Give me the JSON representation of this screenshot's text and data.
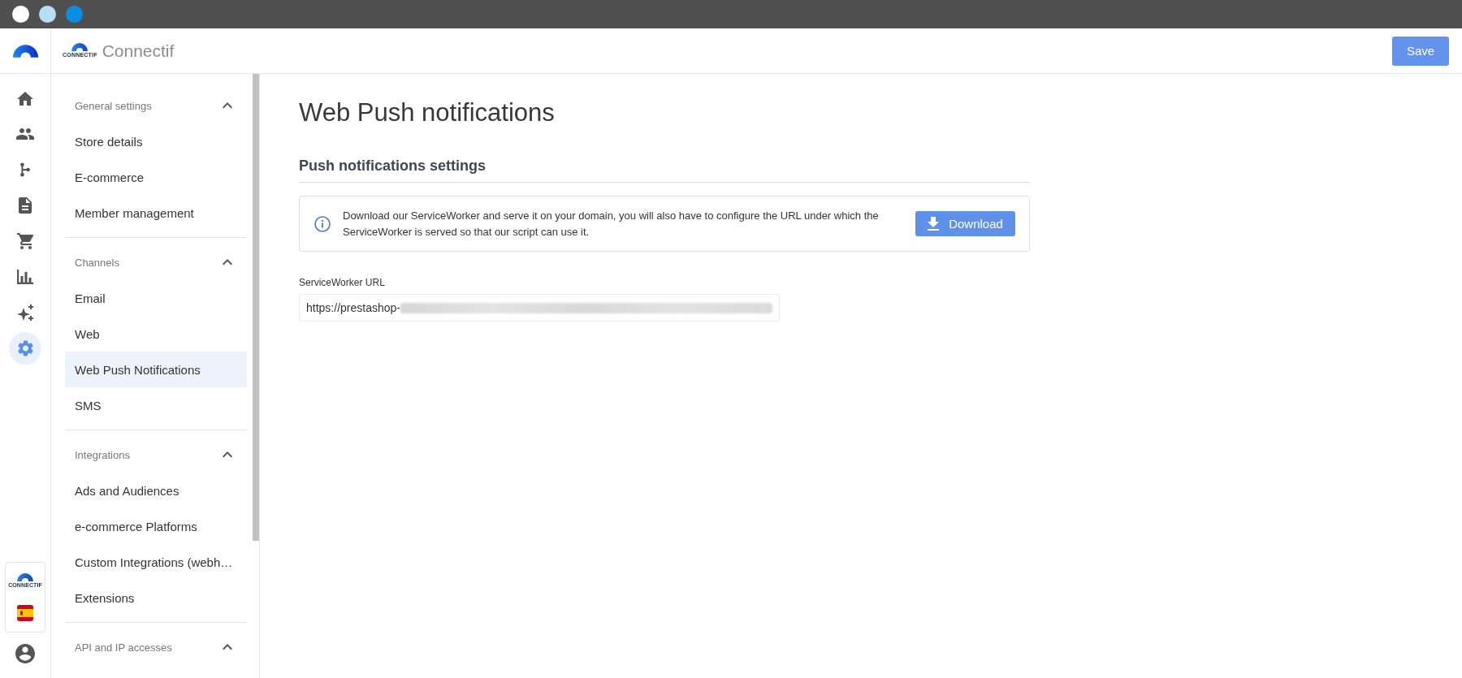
{
  "window": {
    "controls": [
      {
        "color": "#ffffff"
      },
      {
        "color": "#b7def6"
      },
      {
        "color": "#0a8ee3"
      }
    ]
  },
  "rail": {
    "items": [
      {
        "kind": "home",
        "selected": false
      },
      {
        "kind": "people",
        "selected": false
      },
      {
        "kind": "branch",
        "selected": false
      },
      {
        "kind": "document",
        "selected": false
      },
      {
        "kind": "cart",
        "selected": false
      },
      {
        "kind": "chart",
        "selected": false
      },
      {
        "kind": "sparkle",
        "selected": false
      },
      {
        "kind": "settings",
        "selected": true
      }
    ],
    "card_logo_caption": "CONNECTIF"
  },
  "header": {
    "logo_caption": "CONNECTIF",
    "brand": "Connectif",
    "save_button": "Save"
  },
  "sidebar": {
    "sections": [
      {
        "title": "General settings",
        "expanded": true,
        "items": [
          {
            "label": "Store details",
            "selected": false
          },
          {
            "label": "E-commerce",
            "selected": false
          },
          {
            "label": "Member management",
            "selected": false
          }
        ]
      },
      {
        "title": "Channels",
        "expanded": true,
        "items": [
          {
            "label": "Email",
            "selected": false
          },
          {
            "label": "Web",
            "selected": false
          },
          {
            "label": "Web Push Notifications",
            "selected": true
          },
          {
            "label": "SMS",
            "selected": false
          }
        ]
      },
      {
        "title": "Integrations",
        "expanded": true,
        "items": [
          {
            "label": "Ads and Audiences",
            "selected": false
          },
          {
            "label": "e-commerce Platforms",
            "selected": false
          },
          {
            "label": "Custom Integrations (webh…",
            "selected": false
          },
          {
            "label": "Extensions",
            "selected": false
          }
        ]
      },
      {
        "title": "API and IP accesses",
        "expanded": true
      }
    ]
  },
  "page": {
    "title": "Web Push notifications",
    "section_title": "Push notifications settings",
    "info": {
      "text": "Download our ServiceWorker and serve it on your domain, you will also have to configure the URL under which the ServiceWorker is served so that our script can use it.",
      "button": "Download"
    },
    "url_field": {
      "label": "ServiceWorker URL",
      "value": "https://prestashop-",
      "value_blurred": true
    }
  }
}
